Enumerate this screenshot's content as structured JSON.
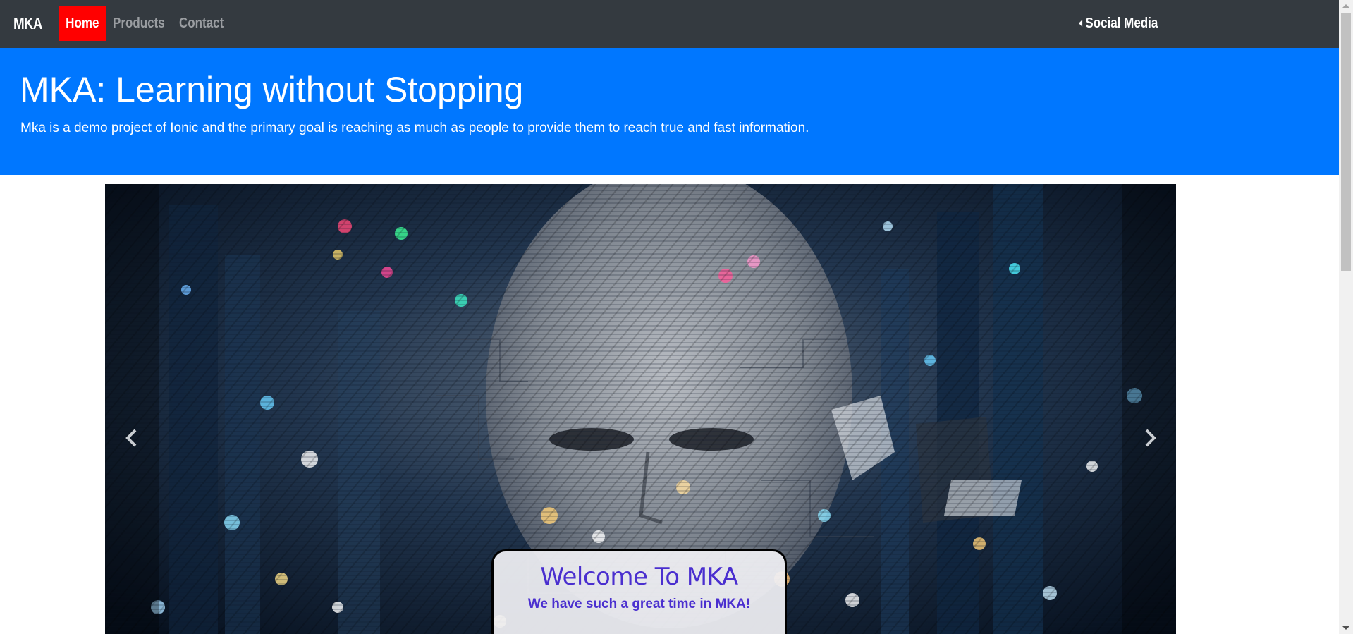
{
  "navbar": {
    "brand": "MKA",
    "items": [
      {
        "label": "Home",
        "active": true
      },
      {
        "label": "Products"
      },
      {
        "label": "Contact"
      }
    ],
    "social_label": "Social Media",
    "active_color": "#ff0000",
    "background": "#343a40"
  },
  "jumbotron": {
    "title": "MKA: Learning without Stopping",
    "subtitle": "Mka is a demo project of Ionic and the primary goal is reaching as much as people to provide them to reach true and fast information.",
    "background": "#0077ff"
  },
  "carousel": {
    "prev_icon": "chevron-left-icon",
    "next_icon": "chevron-right-icon",
    "caption": {
      "heading": "Welcome To MKA",
      "text": "We have such a great time in MKA!"
    }
  }
}
